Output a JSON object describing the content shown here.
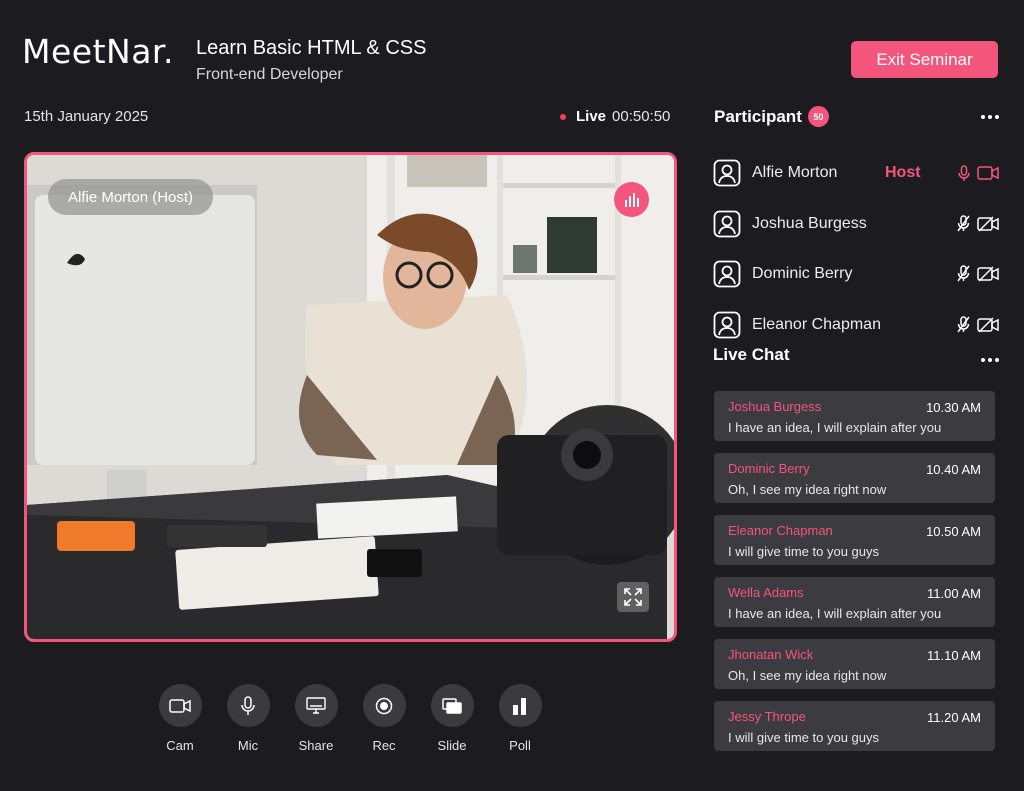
{
  "app": {
    "logo": "MeetNar.",
    "title": "Learn Basic HTML & CSS",
    "subtitle": "Front-end Developer",
    "exit_label": "Exit Seminar",
    "accent": "#f4557c",
    "background": "#1c1c20"
  },
  "session": {
    "date": "15th January 2025",
    "live_label": "Live",
    "elapsed": "00:50:50"
  },
  "video": {
    "speaker_label": "Alfie Morton (Host)",
    "stats_icon": "bar-chart-icon",
    "expand_icon": "expand-icon"
  },
  "controls": [
    {
      "label": "Cam",
      "icon": "camera-icon"
    },
    {
      "label": "Mic",
      "icon": "microphone-icon"
    },
    {
      "label": "Share",
      "icon": "screen-share-icon"
    },
    {
      "label": "Rec",
      "icon": "record-icon"
    },
    {
      "label": "Slide",
      "icon": "slides-icon"
    },
    {
      "label": "Poll",
      "icon": "poll-icon"
    }
  ],
  "participants": {
    "heading": "Participant",
    "count": "50",
    "items": [
      {
        "name": "Alfie Morton",
        "role": "Host",
        "mic": "on",
        "cam": "on"
      },
      {
        "name": "Joshua Burgess",
        "role": "",
        "mic": "off",
        "cam": "off"
      },
      {
        "name": "Dominic Berry",
        "role": "",
        "mic": "off",
        "cam": "off"
      },
      {
        "name": "Eleanor Chapman",
        "role": "",
        "mic": "off",
        "cam": "off"
      }
    ]
  },
  "chat": {
    "heading": "Live Chat",
    "messages": [
      {
        "name": "Joshua Burgess",
        "time": "10.30 AM",
        "text": "I have an idea, I will explain after you"
      },
      {
        "name": "Dominic Berry",
        "time": "10.40 AM",
        "text": "Oh, I see my idea right now"
      },
      {
        "name": "Eleanor Chapman",
        "time": "10.50 AM",
        "text": "I will give time to you guys"
      },
      {
        "name": "Wella Adams",
        "time": "11.00 AM",
        "text": "I have an idea, I will explain after you"
      },
      {
        "name": "Jhonatan Wick",
        "time": "11.10 AM",
        "text": "Oh, I see my idea right now"
      },
      {
        "name": "Jessy Thrope",
        "time": "11.20 AM",
        "text": "I will give time to you guys"
      }
    ]
  }
}
